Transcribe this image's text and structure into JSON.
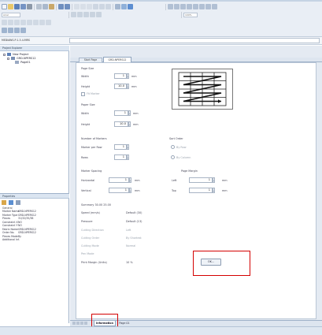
{
  "colors": {
    "chrome": "#e9eef5",
    "panel_border": "#9fb2c9",
    "accent_red": "#d40000",
    "grid_stroke": "#222222"
  },
  "toolbar": {
    "font_combo": "Arial",
    "zoom_combo": "100%",
    "icons": [
      "new-icon",
      "open-icon",
      "save-icon",
      "save-all-icon",
      "print-icon",
      "cut-icon",
      "copy-icon",
      "paste-icon",
      "undo-icon",
      "redo-icon",
      "bold-icon",
      "italic-icon",
      "underline-icon",
      "align-left-icon",
      "align-center-icon",
      "align-right-icon",
      "grid-icon",
      "zoom-icon",
      "help-icon"
    ]
  },
  "address_bar": {
    "value": "MEDIAWS-P-1.3-4-MRS"
  },
  "project_explorer": {
    "title": "Project Explorer",
    "items": [
      {
        "label": "New Project",
        "level": 0
      },
      {
        "label": "GRD-NPERS12",
        "level": 1
      },
      {
        "label": "Page01",
        "level": 2
      }
    ]
  },
  "properties_panel": {
    "title": "Properties",
    "section": "General",
    "rows": [
      {
        "key": "Marker Name",
        "value": "GRD-NPERS12"
      },
      {
        "key": "Marker Type",
        "value": "GRD-NPERS12"
      },
      {
        "key": "Pieces",
        "value": "31/32/35/38"
      },
      {
        "key": "Constraint X",
        "value": "NO"
      },
      {
        "key": "Constraint Y",
        "value": "NO"
      },
      {
        "key": "Fabric Name",
        "value": "GRD-NPERS12"
      },
      {
        "key": "Order No.",
        "value": "GRD-NPERS12"
      },
      {
        "key": "Pieces Mode",
        "value": "By"
      },
      {
        "key": "Additional Inf.",
        "value": ""
      }
    ]
  },
  "editor": {
    "tabs": [
      "Start Page",
      "GRD-NPERS12"
    ],
    "active_tab": 1,
    "page_size": {
      "title": "Page Size",
      "width_label": "Width",
      "width_value": "1",
      "height_label": "Height",
      "height_value": "10.0",
      "unit": "mm",
      "auto_label": "Fit Marker"
    },
    "paper_size": {
      "title": "Paper Size",
      "width_label": "Width",
      "width_value": "1",
      "height_label": "Height",
      "height_value": "10.0",
      "unit": "mm"
    },
    "number_of_markers": {
      "title": "Number of Markers",
      "rows_label": "Marker per Row",
      "rows_value": "1",
      "rows2_label": "Rows",
      "rows2_value": "1"
    },
    "sort_order": {
      "title": "Sort Order",
      "option1": "By Row",
      "option2": "By Column"
    },
    "marker_spacing": {
      "title": "Marker Spacing",
      "horizontal_label": "Horizontal",
      "horizontal_value": "1",
      "vertical_label": "Vertical",
      "vertical_value": "1",
      "unit": "mm"
    },
    "page_margin": {
      "title": "Page Margin",
      "left_label": "Left",
      "left_value": "1",
      "top_label": "Top",
      "top_value": "1",
      "unit": "mm"
    },
    "summary": {
      "header": "Summary 30.00 25.00",
      "speed_label": "Speed (mm/s)",
      "speed_value": "Default (30)",
      "pressure_label": "Pressure",
      "pressure_value": "Default (13)",
      "grey_rows": [
        {
          "label": "Cutting Direction",
          "value": "Left"
        },
        {
          "label": "Cutting Order",
          "value": "By Shortest"
        },
        {
          "label": "Cutting Mode",
          "value": "Normal"
        },
        {
          "label": "Pen Mode",
          "value": ""
        }
      ],
      "final_label": "Print Margin (Units)",
      "final_value": "10 %"
    },
    "apply_button": "OK..."
  },
  "bottom_tabs": [
    "Information",
    "Page 01"
  ],
  "active_bottom_tab": 0
}
